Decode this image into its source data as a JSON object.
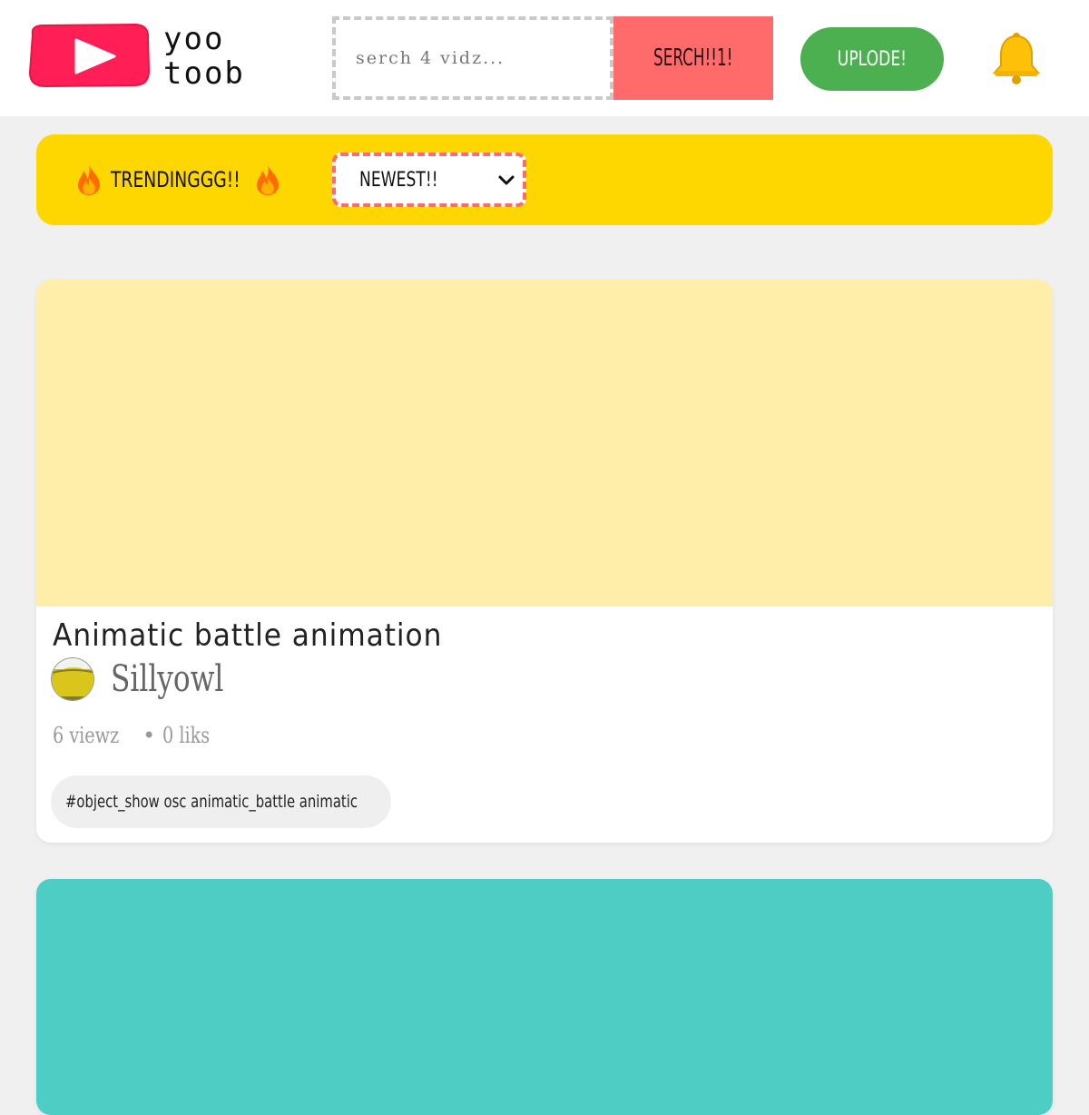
{
  "header": {
    "logo_text": "yoo\ntoob",
    "search": {
      "placeholder": "serch 4 vidz...",
      "value": ""
    },
    "search_button": "SERCH!!1!",
    "upload_button": "UPLODE!",
    "icons": [
      "play-logo-icon",
      "bell-icon"
    ]
  },
  "filter_bar": {
    "trending_label": "TRENDINGGG!!",
    "sort_selected": "NEWEST!!",
    "icons": [
      "fire-icon",
      "chevron-down-icon"
    ]
  },
  "videos": [
    {
      "title": "Animatic battle animation",
      "channel": "Sillyowl",
      "views": "6 viewz",
      "likes": "0 liks",
      "separator": "•",
      "tags": "#object_show osc animatic_battle animatic",
      "thumbnail_color": "#ffeeaa"
    },
    {
      "thumbnail_color": "#4ecdc4"
    }
  ],
  "colors": {
    "page_bg": "#f0f0f0",
    "accent_red": "#ff6b6b",
    "upload_green": "#4caf50",
    "filter_yellow": "#ffd700",
    "logo_red": "#ff1744"
  }
}
